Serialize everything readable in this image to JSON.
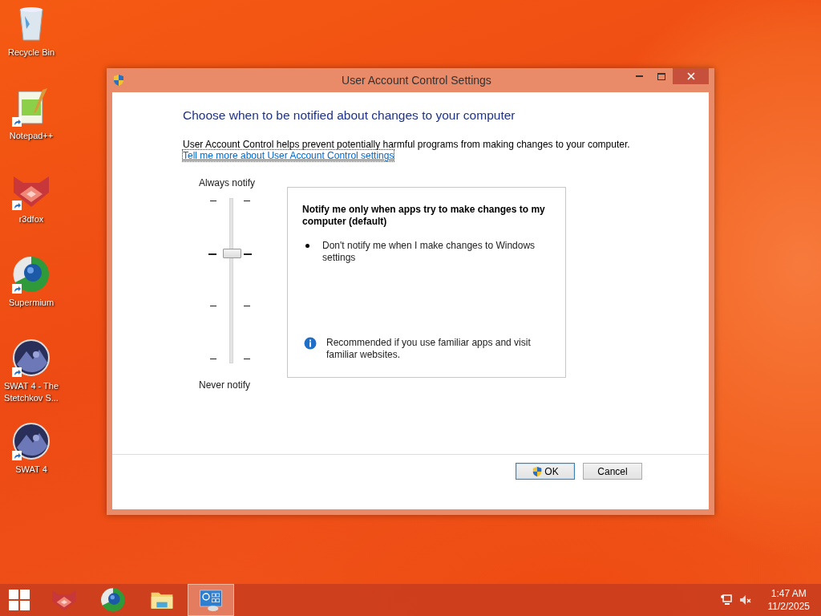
{
  "desktop_icons": [
    {
      "kind": "recycle",
      "label": "Recycle Bin",
      "shortcut": false
    },
    {
      "kind": "notepad",
      "label": "Notepad++",
      "shortcut": true
    },
    {
      "kind": "fox",
      "label": "r3dfox",
      "shortcut": true
    },
    {
      "kind": "browser",
      "label": "Supermium",
      "shortcut": true
    },
    {
      "kind": "game",
      "label": "SWAT 4 - The Stetchkov S...",
      "shortcut": true
    },
    {
      "kind": "game",
      "label": "SWAT 4",
      "shortcut": true
    }
  ],
  "window": {
    "title": "User Account Control Settings",
    "heading": "Choose when to be notified about changes to your computer",
    "description": "User Account Control helps prevent potentially harmful programs from making changes to your computer.",
    "link": "Tell me more about User Account Control settings",
    "slider": {
      "top_label": "Always notify",
      "bottom_label": "Never notify",
      "level": 0.667
    },
    "info_panel": {
      "title": "Notify me only when apps try to make changes to my computer (default)",
      "bullets": [
        "Don't notify me when I make changes to Windows settings"
      ],
      "note": "Recommended if you use familiar apps and visit familiar websites."
    },
    "buttons": [
      {
        "kind": "shield",
        "label": "OK"
      },
      {
        "kind": "plain",
        "label": "Cancel"
      }
    ]
  },
  "taskbar": {
    "items": [
      {
        "kind": "fox",
        "selected": false
      },
      {
        "kind": "browser",
        "selected": false
      },
      {
        "kind": "folder",
        "selected": false
      },
      {
        "kind": "uac",
        "selected": true
      }
    ],
    "time": "1:47 AM",
    "date": "11/2/2025"
  }
}
